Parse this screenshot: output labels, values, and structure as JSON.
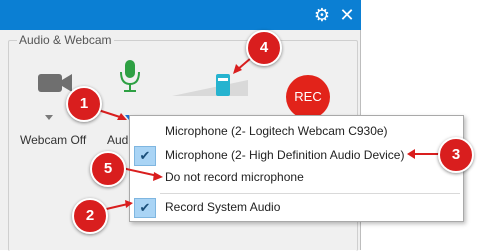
{
  "group": {
    "label": "Audio & Webcam"
  },
  "tools": {
    "webcam_label": "Webcam Off",
    "audio_label": "Aud",
    "rec_label": "REC"
  },
  "menu": {
    "items": [
      {
        "label": "Microphone (2- Logitech Webcam C930e)",
        "checked": false
      },
      {
        "label": "Microphone (2- High Definition Audio Device)",
        "checked": true
      },
      {
        "label": "Do not record microphone",
        "checked": false
      },
      {
        "label": "Record System Audio",
        "checked": true
      }
    ]
  },
  "callouts": [
    "1",
    "2",
    "3",
    "4",
    "5"
  ],
  "colors": {
    "titlebar": "#0b7fd3",
    "rec": "#e2231a",
    "mic": "#2ea043",
    "badge": "#d91e1e",
    "check": "#a9d4f5"
  },
  "icons": [
    "gear-icon",
    "close-icon",
    "webcam-off-icon",
    "microphone-icon",
    "volume-slider-icon",
    "checkmark-icon"
  ]
}
